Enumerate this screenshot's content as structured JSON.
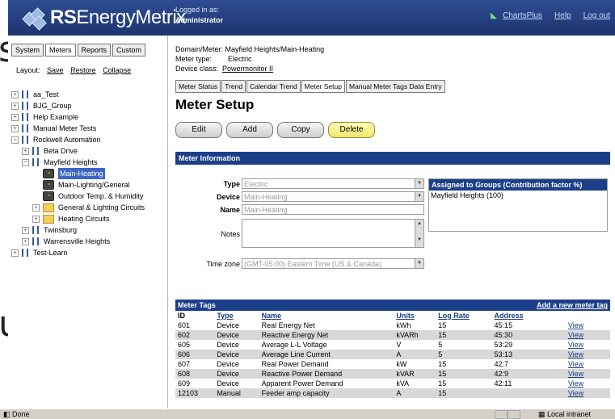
{
  "app": {
    "logo_text_bold": "RS",
    "logo_text": "EnergyMetrix",
    "logged_label": "Logged in as:",
    "user": "Administrator",
    "links": [
      "ChartsPlus",
      "Help",
      "Log out"
    ]
  },
  "left": {
    "tabs": [
      "System",
      "Meters",
      "Reports",
      "Custom"
    ],
    "active_tab": "Meters",
    "layout_label": "Layout:",
    "layout_links": [
      "Save",
      "Restore",
      "Collapse"
    ],
    "tree": [
      {
        "label": "aa_Test",
        "indent": 0,
        "exp": "+",
        "icon": "tree"
      },
      {
        "label": "BJG_Group",
        "indent": 0,
        "exp": "+",
        "icon": "tree"
      },
      {
        "label": "Help Example",
        "indent": 0,
        "exp": "+",
        "icon": "tree"
      },
      {
        "label": "Manual Meter Tests",
        "indent": 0,
        "exp": "+",
        "icon": "tree"
      },
      {
        "label": "Rockwell Automation",
        "indent": 0,
        "exp": "-",
        "icon": "tree"
      },
      {
        "label": "Beta Drive",
        "indent": 1,
        "exp": "+",
        "icon": "tree"
      },
      {
        "label": "Mayfield Heights",
        "indent": 1,
        "exp": "-",
        "icon": "tree"
      },
      {
        "label": "Main-Heating",
        "indent": 2,
        "exp": "",
        "icon": "meter",
        "selected": true
      },
      {
        "label": "Main-Lighting/General",
        "indent": 2,
        "exp": "",
        "icon": "meter"
      },
      {
        "label": "Outdoor Temp. & Humidity",
        "indent": 2,
        "exp": "",
        "icon": "meter"
      },
      {
        "label": "General & Lighting Circuits",
        "indent": 2,
        "exp": "+",
        "icon": "folder"
      },
      {
        "label": "Heating Circuits",
        "indent": 2,
        "exp": "+",
        "icon": "folder"
      },
      {
        "label": "Twinsburg",
        "indent": 1,
        "exp": "+",
        "icon": "tree"
      },
      {
        "label": "Warrensville Heights",
        "indent": 1,
        "exp": "+",
        "icon": "tree"
      },
      {
        "label": "Test-Learn",
        "indent": 0,
        "exp": "+",
        "icon": "tree"
      }
    ]
  },
  "main": {
    "domain_meter_label": "Domain/Meter:",
    "domain_meter": "Mayfield Heights/Main-Heating",
    "meter_type_label": "Meter type:",
    "meter_type": "Electric",
    "device_class_label": "Device class:",
    "device_class": "Powermonitor II",
    "tabs": [
      "Meter Status",
      "Trend",
      "Calendar Trend",
      "Meter Setup",
      "Manual Meter Tags Data Entry"
    ],
    "active_tab": "Meter Setup",
    "title": "Meter Setup",
    "buttons": {
      "edit": "Edit",
      "add": "Add",
      "copy": "Copy",
      "delete": "Delete"
    },
    "info_header": "Meter Information",
    "form": {
      "type_label": "Type",
      "type_value": "Electric",
      "device_label": "Device",
      "device_value": "Main-Heating",
      "name_label": "Name",
      "name_value": "Main-Heating",
      "notes_label": "Notes",
      "tz_label": "Time zone",
      "tz_value": "(GMT-05:00) Eastern Time (US & Canada)"
    },
    "groups_header": "Assigned to Groups (Contribution factor %)",
    "groups_value": "Mayfield Heights (100)",
    "tags": {
      "header": "Meter Tags",
      "add_link": "Add a new meter tag",
      "columns": [
        "ID",
        "Type",
        "Name",
        "Units",
        "Log Rate",
        "Address",
        ""
      ],
      "rows": [
        [
          "601",
          "Device",
          "Real Energy Net",
          "kWh",
          "15",
          "45:15",
          "View"
        ],
        [
          "602",
          "Device",
          "Reactive Energy Net",
          "kVARh",
          "15",
          "45:30",
          "View"
        ],
        [
          "605",
          "Device",
          "Average L-L Voltage",
          "V",
          "5",
          "53:29",
          "View"
        ],
        [
          "606",
          "Device",
          "Average Line Current",
          "A",
          "5",
          "53:13",
          "View"
        ],
        [
          "607",
          "Device",
          "Real Power Demand",
          "kW",
          "15",
          "42:7",
          "View"
        ],
        [
          "608",
          "Device",
          "Reactive Power Demand",
          "kVAR",
          "15",
          "42:9",
          "View"
        ],
        [
          "609",
          "Device",
          "Apparent Power Demand",
          "kVA",
          "15",
          "42:11",
          "View"
        ],
        [
          "12103",
          "Manual",
          "Feeder amp capacity",
          "A",
          "15",
          "",
          "View"
        ]
      ]
    }
  },
  "status": {
    "left": "Done",
    "right": "Local intranet"
  }
}
